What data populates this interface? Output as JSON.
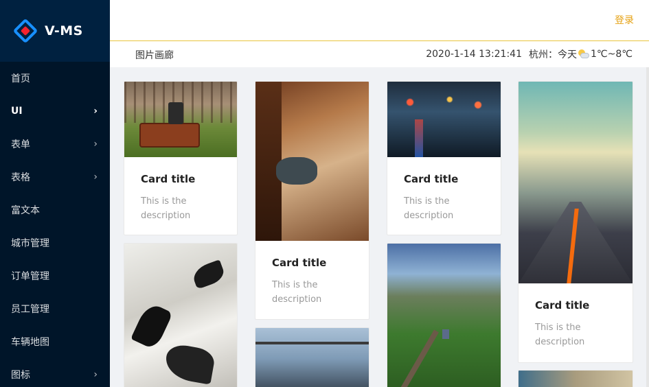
{
  "sidebar": {
    "brand": "V-MS",
    "items": [
      {
        "label": "首页",
        "chevron": false
      },
      {
        "label": "UI",
        "chevron": true,
        "active": true
      },
      {
        "label": "表单",
        "chevron": true
      },
      {
        "label": "表格",
        "chevron": true
      },
      {
        "label": "富文本",
        "chevron": false
      },
      {
        "label": "城市管理",
        "chevron": false
      },
      {
        "label": "订单管理",
        "chevron": false
      },
      {
        "label": "员工管理",
        "chevron": false
      },
      {
        "label": "车辆地图",
        "chevron": false
      },
      {
        "label": "图标",
        "chevron": true
      }
    ]
  },
  "header": {
    "login": "登录",
    "breadcrumb": "图片画廊",
    "datetime": "2020-1-14 13:21:41",
    "city": "杭州：今天",
    "weather_icon": "partly-cloudy-icon",
    "temperature": "1℃~8℃"
  },
  "cards": [
    {
      "title": "Card title",
      "description": "This is the description"
    },
    {
      "title": "Card title",
      "description": "This is the description"
    },
    {
      "title": "Card title",
      "description": "This is the description"
    },
    {
      "title": "Card title",
      "description": "This is the description"
    }
  ],
  "colors": {
    "sidebar_bg": "#001529",
    "brand_bg": "#002140",
    "accent": "#e5a214",
    "logo_blue": "#1890ff",
    "logo_red": "#f5222d"
  }
}
